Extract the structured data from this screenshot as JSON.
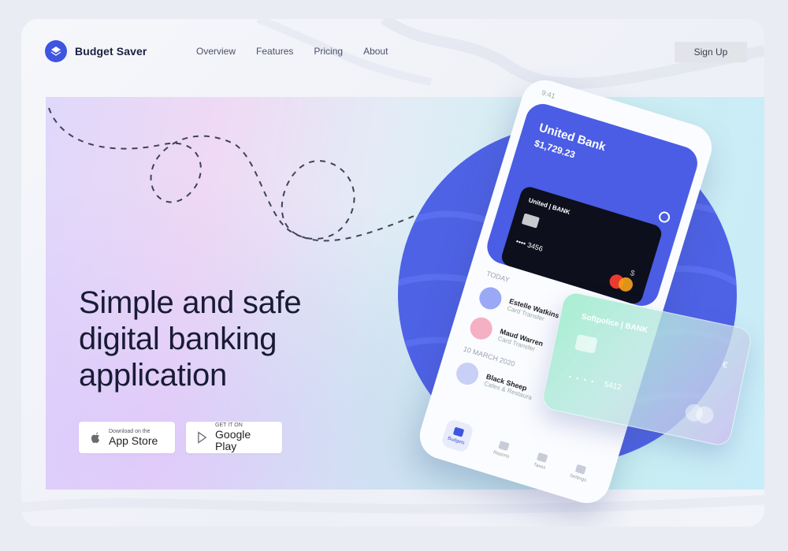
{
  "brand": {
    "name": "Budget Saver",
    "accent": "#3d55e0"
  },
  "nav": {
    "items": [
      "Overview",
      "Features",
      "Pricing",
      "About"
    ]
  },
  "header": {
    "signup_label": "Sign Up"
  },
  "hero": {
    "headline_lines": [
      "Simple and safe",
      "digital banking",
      "application"
    ],
    "app_store": {
      "small": "Download on the",
      "big": "App Store"
    },
    "google_play": {
      "small": "GET IT ON",
      "big": "Google Play"
    }
  },
  "phone": {
    "time": "9:41",
    "bank_name": "United Bank",
    "balance": "$1,729.23",
    "card": {
      "title": "United | BANK",
      "number": "•••• 3456",
      "symbol": "$"
    },
    "today_label": "TODAY",
    "transactions": [
      {
        "name": "Estelle Watkins",
        "sub": "Card Transfer"
      },
      {
        "name": "Maud Warren",
        "sub": "Card Transfer"
      },
      {
        "name": "Black Sheep",
        "sub": "Cafes & Restaura"
      }
    ],
    "date_label": "10 MARCH 2020",
    "tabs": [
      "Budgets",
      "Reports",
      "Taxes",
      "Settings"
    ]
  },
  "glass_card": {
    "title": "Softpolice | BANK",
    "dots": "• • • •",
    "number": "5412",
    "currency": "€"
  }
}
